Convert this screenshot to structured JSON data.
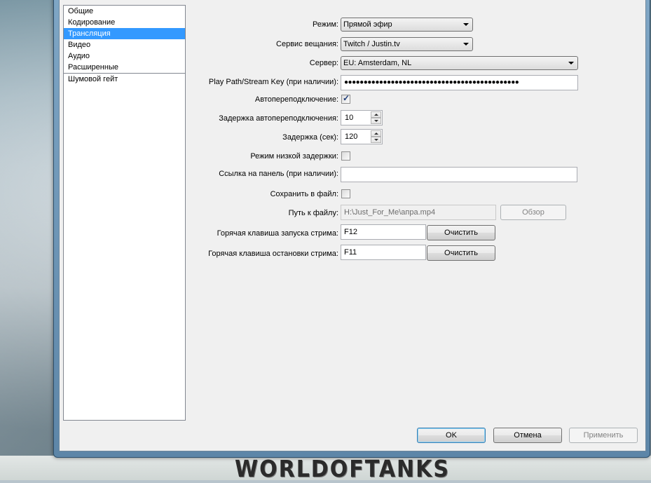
{
  "sidebar": {
    "items": [
      "Общие",
      "Кодирование",
      "Трансляция",
      "Видео",
      "Аудио",
      "Расширенные"
    ],
    "extra_items": [
      "Шумовой гейт"
    ],
    "selected_index": 2
  },
  "settings": {
    "mode": {
      "label": "Режим:",
      "value": "Прямой эфир"
    },
    "service": {
      "label": "Сервис вещания:",
      "value": "Twitch / Justin.tv"
    },
    "server": {
      "label": "Сервер:",
      "value": "EU: Amsterdam, NL"
    },
    "stream_key": {
      "label": "Play Path/Stream Key (при наличии):",
      "value": "●●●●●●●●●●●●●●●●●●●●●●●●●●●●●●●●●●●●●●●●●●●●●"
    },
    "auto_reconnect": {
      "label": "Автопереподключение:",
      "checked": true
    },
    "reconnect_delay": {
      "label": "Задержка автопереподключения:",
      "value": "10"
    },
    "delay": {
      "label": "Задержка (сек):",
      "value": "120"
    },
    "low_latency": {
      "label": "Режим низкой задержки:",
      "checked": false
    },
    "dashboard_link": {
      "label": "Ссылка на панель (при наличии):",
      "value": ""
    },
    "save_to_file": {
      "label": "Сохранить в файл:",
      "checked": false
    },
    "file_path": {
      "label": "Путь к файлу:",
      "value": "H:\\Just_For_Me\\апра.mp4",
      "browse_label": "Обзор"
    },
    "start_hotkey": {
      "label": "Горячая клавиша запуска стрима:",
      "value": "F12",
      "clear_label": "Очистить"
    },
    "stop_hotkey": {
      "label": "Горячая клавиша остановки стрима:",
      "value": "F11",
      "clear_label": "Очистить"
    }
  },
  "footer": {
    "ok_label": "OK",
    "cancel_label": "Отмена",
    "apply_label": "Применить"
  },
  "background": {
    "logo_text": "WORLDOFTANKS"
  },
  "colors": {
    "selection": "#3399ff",
    "window_frame": "#6f97b9"
  }
}
